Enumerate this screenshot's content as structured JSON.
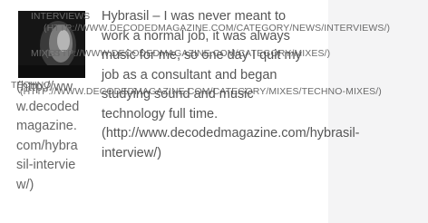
{
  "post": {
    "thumbnail_alt": "Hybrasil portrait",
    "permalink_text": "(http://www.decodedmagazine.com/hybrasil-interview/)",
    "excerpt": "Hybrasil – I was never meant to work a normal job, it was always music for me, so one day I quit my job as a consultant and began studying sound and music technology full time.",
    "excerpt_link": "(http://www.decodedmagazine.com/hybrasil-interview/)"
  },
  "categories": [
    {
      "label": "INTERVIEWS",
      "url_text": "(HTTP://WWW.DECODEDMAGAZINE.COM/CATEGORY/NEWS/INTERVIEWS/)"
    },
    {
      "label": "MIXES",
      "url_text": "(HTTP://WWW.DECODEDMAGAZINE.COM/CATEGORY/MIXES/)"
    },
    {
      "label": "TECHNO",
      "url_text": "(HTTP://WWW.DECODEDMAGAZINE.COM/CATEGORY/MIXES/TECHNO-MIXES/)"
    }
  ],
  "colors": {
    "text": "#555555",
    "sidebar_bg": "#f4f4f5",
    "thumb_bg": "#1a1a1a"
  }
}
